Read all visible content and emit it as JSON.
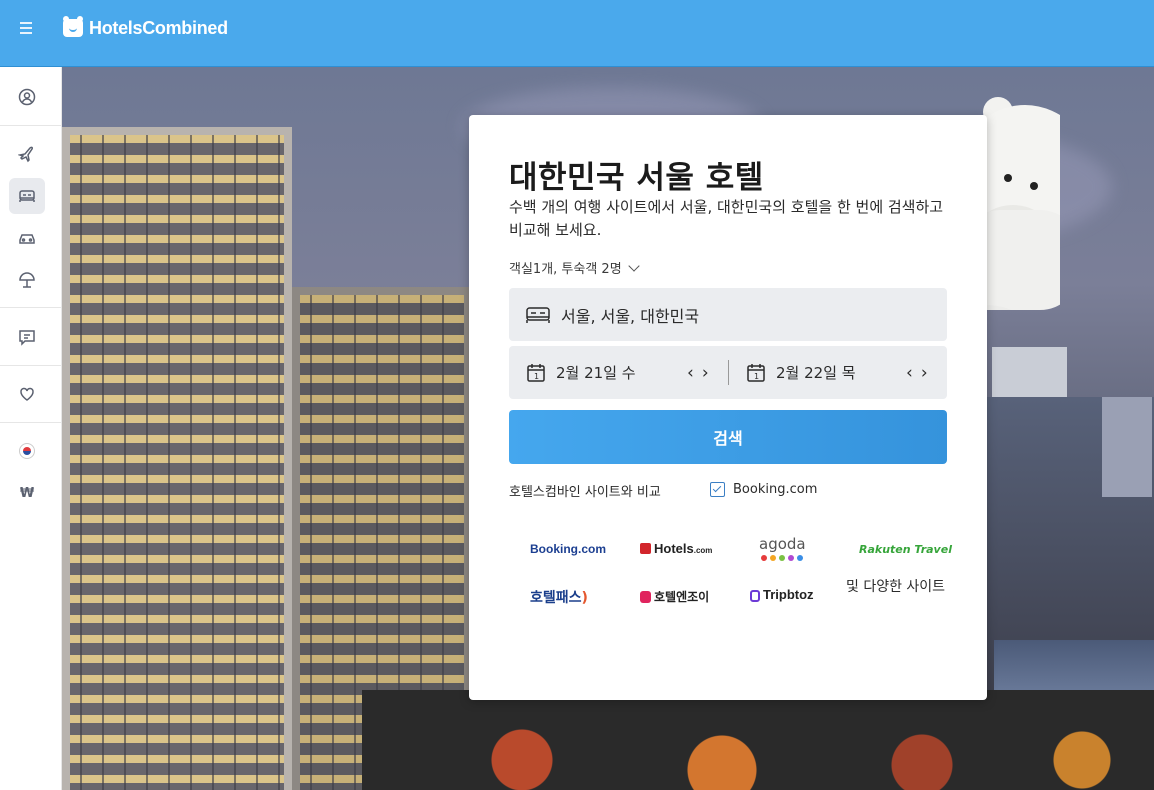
{
  "header": {
    "logo_text": "HotelsCombined",
    "menu_icon": "hamburger-menu-icon"
  },
  "sidebar": {
    "items": [
      {
        "icon": "user-account-icon"
      },
      {
        "icon": "airplane-icon"
      },
      {
        "icon": "bed-icon",
        "active": true
      },
      {
        "icon": "car-icon"
      },
      {
        "icon": "beach-umbrella-icon"
      },
      {
        "icon": "feedback-icon"
      },
      {
        "icon": "heart-icon"
      },
      {
        "icon": "korea-flag-icon"
      },
      {
        "currency": "₩"
      }
    ]
  },
  "search_card": {
    "title": "대한민국 서울 호텔",
    "subtitle": "수백 개의 여행 사이트에서 서울, 대한민국의 호텔을 한 번에 검색하고 비교해 보세요.",
    "guests": "객실1개, 투숙객 2명",
    "destination": "서울, 서울, 대한민국",
    "checkin": "2월 21일 수",
    "checkout": "2월 22일 목",
    "prev_arrow": "‹",
    "next_arrow": "›",
    "search_label": "검색",
    "compare_label": "호텔스컴바인 사이트와 비교",
    "compare_site": "Booking.com",
    "compare_checked": true,
    "partners": [
      {
        "name": "Booking.com",
        "color": "#1c3f91"
      },
      {
        "name": "Hotels",
        "suffix": ".com",
        "color": "#d2252b"
      },
      {
        "name": "agoda",
        "color": "#555555"
      },
      {
        "name": "Rakuten Travel",
        "color": "#36a53a"
      },
      {
        "name": "호텔패스",
        "color": "#1b3f8c"
      },
      {
        "name": "호텔엔조이",
        "color": "#222222"
      },
      {
        "name": "Tripbtoz",
        "color": "#222222"
      }
    ],
    "more_sites": "및 다양한 사이트"
  },
  "colors": {
    "header_bg": "#4aa9ec",
    "search_button": "#3b9be3"
  }
}
